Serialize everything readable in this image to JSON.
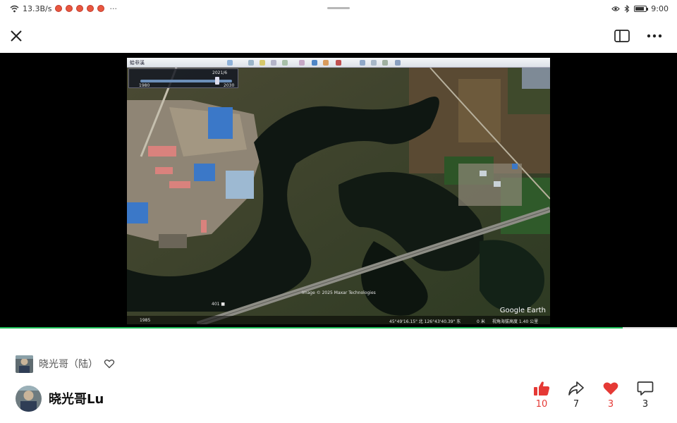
{
  "status_bar": {
    "speed": "13.3B/s",
    "more": "···",
    "time": "9:00",
    "battery_level": 0.85
  },
  "icons": {
    "wifi": "wifi-icon",
    "close": "close-icon",
    "layout": "panel-layout-icon",
    "more": "more-icon",
    "eye": "eye-icon",
    "bluetooth": "bluetooth-icon",
    "battery": "battery-icon",
    "thumbs_up": "thumbs-up-icon",
    "share": "share-icon",
    "heart": "heart-icon",
    "comment": "comment-icon"
  },
  "video": {
    "ge_title": "蛤非溪",
    "timeslider_date": "2021/6",
    "timeslider_start": "1980",
    "timeslider_end": "2030",
    "label_401": "401 ■",
    "imagery_credit": "Image © 2025 Maxar Technologies",
    "coordinates": "45°49'16.15\" 北  126°43'40.39\" 东",
    "altitude_label": "0 米",
    "eye_alt": "视角海拔高度  1.40 公里",
    "year_bottom": "1985",
    "logo": "Google Earth",
    "playback_progress": 0.92
  },
  "author": {
    "name": "晓光哥（陆）"
  },
  "user": {
    "name": "晓光哥Lu"
  },
  "actions": {
    "likes": "10",
    "shares": "7",
    "favorites": "3",
    "comments": "3"
  },
  "colors": {
    "like_red": "#e53935",
    "progress_green": "#1fbf5a"
  }
}
